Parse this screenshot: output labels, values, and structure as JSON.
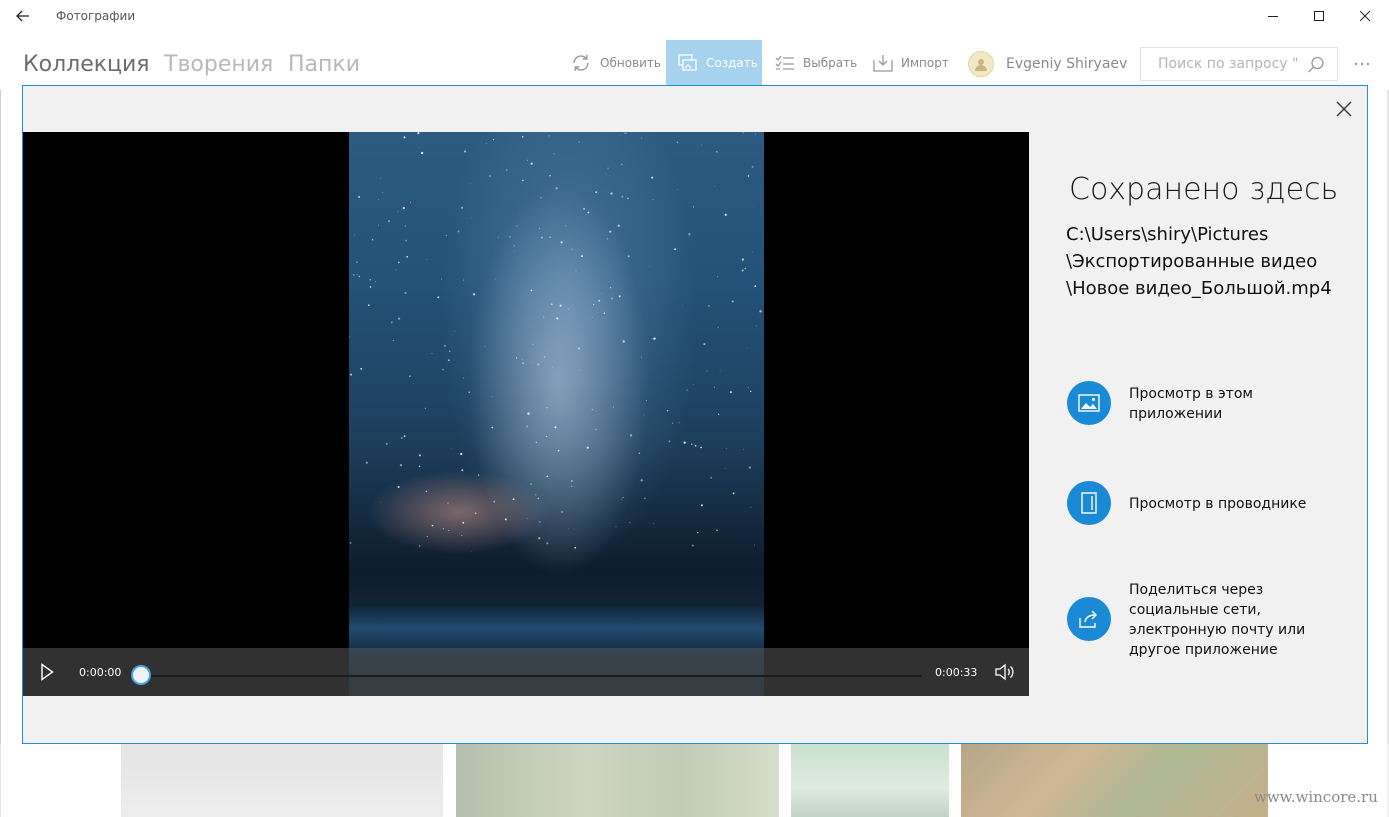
{
  "window": {
    "title": "Фотографии"
  },
  "nav": {
    "pivots": [
      "Коллекция",
      "Творения",
      "Папки"
    ]
  },
  "commands": {
    "refresh": "Обновить",
    "create": "Создать",
    "select": "Выбрать",
    "import": "Импорт"
  },
  "user": {
    "name": "Evgeniy Shiryaev"
  },
  "search": {
    "placeholder": "Поиск по запросу \""
  },
  "player": {
    "current_time": "0:00:00",
    "total_time": "0:00:33",
    "progress": 0
  },
  "panel": {
    "heading": "Сохранено здесь",
    "path_lines": [
      "C:\\Users\\shiry\\Pictures",
      "\\Экспортированные видео",
      "\\Новое видео_Большой.mp4"
    ],
    "actions": [
      {
        "icon": "picture-icon",
        "label": "Просмотр в этом приложении"
      },
      {
        "icon": "folder-icon",
        "label": "Просмотр в проводнике"
      },
      {
        "icon": "share-icon",
        "label": "Поделиться через социальные сети, электронную почту или другое приложение"
      }
    ]
  },
  "watermark": "www.wincore.ru",
  "colors": {
    "accent": "#1b8ad6",
    "accent_light": "#a6d2ee",
    "dialog_border": "#1e90d6"
  }
}
